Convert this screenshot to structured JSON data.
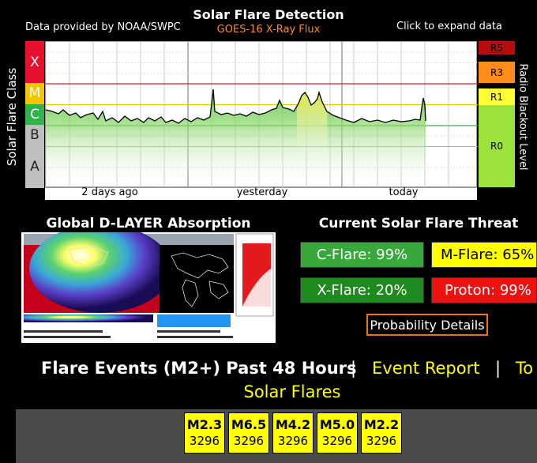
{
  "flare_chart": {
    "title": "Solar Flare Detection",
    "subtitle": "GOES-16 X-Ray Flux",
    "source_note": "Data provided by NOAA/SWPC",
    "expand_hint": "Click to expand data",
    "y_axis_left": "Solar Flare Class",
    "y_axis_right": "Radio Blackout Level",
    "classes": [
      "X",
      "M",
      "C",
      "B",
      "A"
    ],
    "class_colors": {
      "X": "#e8112d",
      "M": "#f5c400",
      "C": "#2fb34a",
      "B": "#bfbfbf",
      "A": "#bfbfbf"
    },
    "radio_levels": [
      "R5",
      "R3",
      "R1",
      "R0"
    ],
    "radio_colors": {
      "R5": "#b50d0d",
      "R3": "#ff8c1a",
      "R1": "#ffff33",
      "R0": "#9be23a"
    },
    "x_ticks": [
      "2 days ago",
      "yesterday",
      "today"
    ]
  },
  "absorption": {
    "title": "Global D-LAYER Absorption"
  },
  "threat": {
    "title": "Current Solar Flare Threat",
    "c_flare": "C-Flare: 99%",
    "m_flare": "M-Flare: 65%",
    "x_flare": "X-Flare: 20%",
    "proton": "Proton: 99%",
    "colors": {
      "c_flare": "#38a83d",
      "m_flare": "#ffff00",
      "x_flare": "#1f8a1f",
      "proton": "#ee1111"
    },
    "details_button": "Probability Details"
  },
  "events": {
    "heading": "Flare Events (M2+) Past 48 Hours",
    "separator": "|",
    "report_link": "Event Report",
    "truncated_link": "To",
    "second_line_link": "Solar Flares",
    "items": [
      {
        "class": "M2.3",
        "region": "3296"
      },
      {
        "class": "M6.5",
        "region": "3296"
      },
      {
        "class": "M4.2",
        "region": "3296"
      },
      {
        "class": "M5.0",
        "region": "3296"
      },
      {
        "class": "M2.2",
        "region": "3296"
      }
    ]
  }
}
